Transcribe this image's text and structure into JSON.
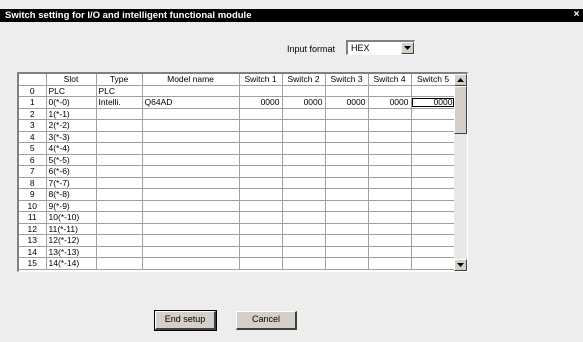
{
  "window": {
    "title": "Switch setting for I/O and intelligent functional module",
    "close_glyph": "×"
  },
  "input_format": {
    "label": "Input format",
    "value": "HEX"
  },
  "grid": {
    "columns": [
      "",
      "Slot",
      "Type",
      "Model name",
      "Switch 1",
      "Switch 2",
      "Switch 3",
      "Switch 4",
      "Switch 5"
    ],
    "rows": [
      [
        "0",
        "PLC",
        "PLC",
        "",
        "",
        "",
        "",
        "",
        ""
      ],
      [
        "1",
        "0(*-0)",
        "Intelli.",
        "Q64AD",
        "0000",
        "0000",
        "0000",
        "0000",
        "0000"
      ],
      [
        "2",
        "1(*-1)",
        "",
        "",
        "",
        "",
        "",
        "",
        ""
      ],
      [
        "3",
        "2(*-2)",
        "",
        "",
        "",
        "",
        "",
        "",
        ""
      ],
      [
        "4",
        "3(*-3)",
        "",
        "",
        "",
        "",
        "",
        "",
        ""
      ],
      [
        "5",
        "4(*-4)",
        "",
        "",
        "",
        "",
        "",
        "",
        ""
      ],
      [
        "6",
        "5(*-5)",
        "",
        "",
        "",
        "",
        "",
        "",
        ""
      ],
      [
        "7",
        "6(*-6)",
        "",
        "",
        "",
        "",
        "",
        "",
        ""
      ],
      [
        "8",
        "7(*-7)",
        "",
        "",
        "",
        "",
        "",
        "",
        ""
      ],
      [
        "9",
        "8(*-8)",
        "",
        "",
        "",
        "",
        "",
        "",
        ""
      ],
      [
        "10",
        "9(*-9)",
        "",
        "",
        "",
        "",
        "",
        "",
        ""
      ],
      [
        "11",
        "10(*-10)",
        "",
        "",
        "",
        "",
        "",
        "",
        ""
      ],
      [
        "12",
        "11(*-11)",
        "",
        "",
        "",
        "",
        "",
        "",
        ""
      ],
      [
        "13",
        "12(*-12)",
        "",
        "",
        "",
        "",
        "",
        "",
        ""
      ],
      [
        "14",
        "13(*-13)",
        "",
        "",
        "",
        "",
        "",
        "",
        ""
      ],
      [
        "15",
        "14(*-14)",
        "",
        "",
        "",
        "",
        "",
        "",
        ""
      ]
    ]
  },
  "buttons": {
    "end_setup": "End setup",
    "cancel": "Cancel"
  }
}
